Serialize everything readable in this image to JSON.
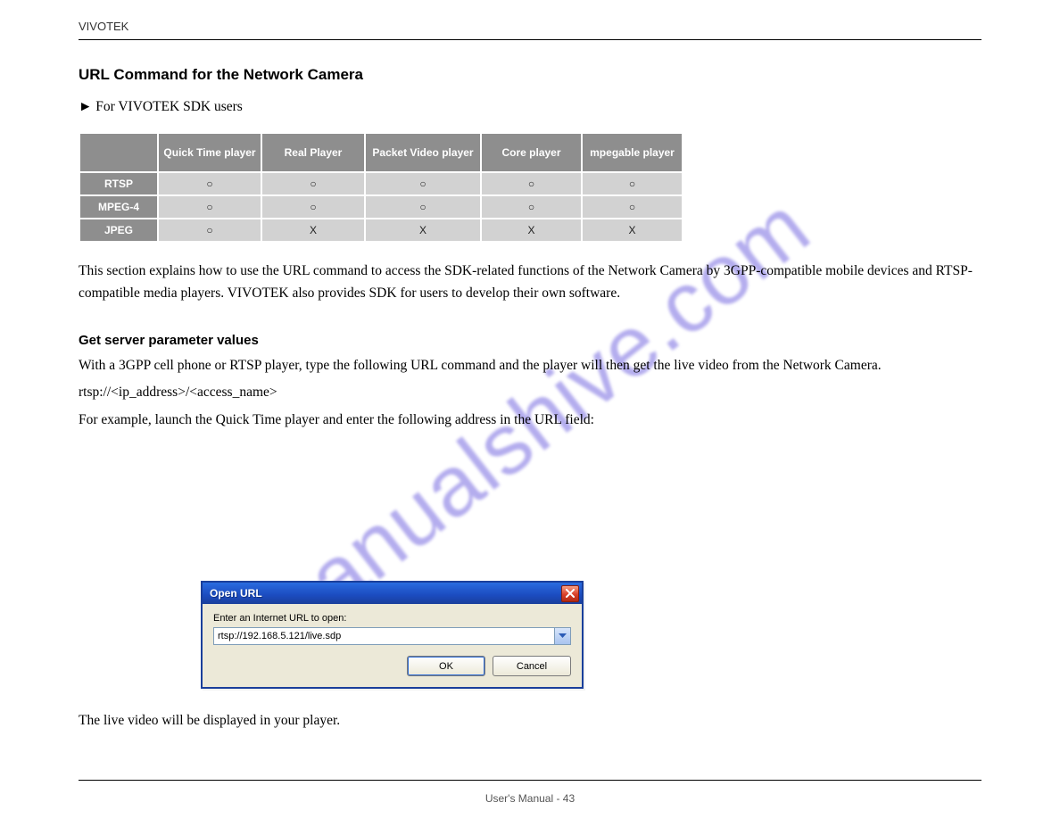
{
  "header": {
    "running_head": "VIVOTEK",
    "section_title": "URL Command for the Network Camera",
    "lead": "► For VIVOTEK SDK users",
    "page_number": "User's Manual - 43"
  },
  "table": {
    "cols": [
      "",
      "Quick Time player",
      "Real Player",
      "Packet Video player",
      "Core player",
      "mpegable player"
    ],
    "rows": [
      {
        "head": "RTSP",
        "cells": [
          "○",
          "○",
          "○",
          "○",
          "○"
        ]
      },
      {
        "head": "MPEG-4",
        "cells": [
          "○",
          "○",
          "○",
          "○",
          "○"
        ]
      },
      {
        "head": "JPEG",
        "cells": [
          "○",
          "X",
          "X",
          "X",
          "X"
        ]
      }
    ]
  },
  "intro": {
    "p1": "This section explains how to use the URL command to access the SDK-related functions of the Network Camera by 3GPP-compatible mobile devices and RTSP-compatible media players. VIVOTEK also provides SDK for users to develop their own software.",
    "sub_head": "Get server parameter values",
    "p2": "With a 3GPP cell phone or RTSP player, type the following URL command and the player will then get the live video from the Network Camera.",
    "p3": "rtsp://<ip_address>/<access_name>",
    "p4": "For example, launch the Quick Time player and enter the following address in the URL field:"
  },
  "dialog": {
    "title": "Open URL",
    "label": "Enter an Internet URL to open:",
    "value": "rtsp://192.168.5.121/live.sdp",
    "ok": "OK",
    "cancel": "Cancel"
  },
  "after": "The live video will be displayed in your player.",
  "watermark": "manualshive.com"
}
